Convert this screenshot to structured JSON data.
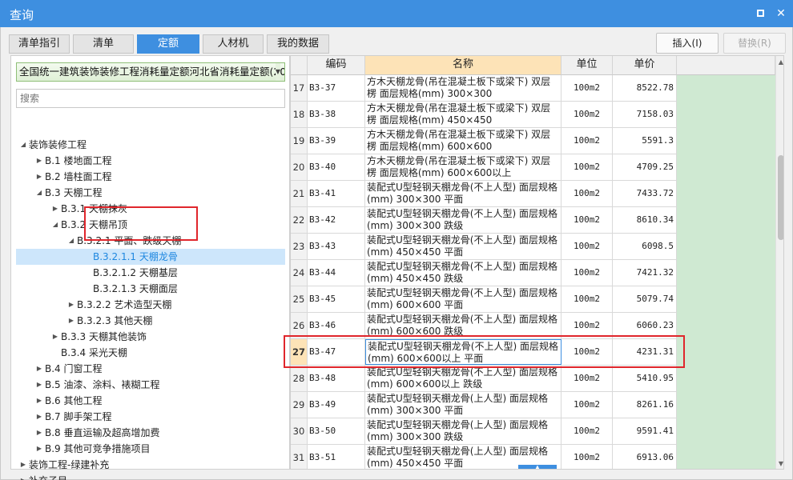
{
  "window": {
    "title": "查询"
  },
  "tabs": [
    {
      "label": "清单指引",
      "active": false
    },
    {
      "label": "清单",
      "active": false
    },
    {
      "label": "定额",
      "active": true
    },
    {
      "label": "人材机",
      "active": false
    },
    {
      "label": "我的数据",
      "active": false
    }
  ],
  "toolbar": {
    "insert_label": "插入(I)",
    "replace_label": "替换(R)"
  },
  "left": {
    "library_select": "全国统一建筑装饰装修工程消耗量定额河北省消耗量定额(20",
    "search_placeholder": "搜索",
    "tree": [
      {
        "label": "装饰装修工程",
        "toggle": "◢"
      },
      {
        "label": "B.1 楼地面工程",
        "toggle": "▶"
      },
      {
        "label": "B.2 墙柱面工程",
        "toggle": "▶"
      },
      {
        "label": "B.3 天棚工程",
        "toggle": "◢"
      },
      {
        "label": "B.3.1 天棚抹灰",
        "toggle": "▶"
      },
      {
        "label": "B.3.2 天棚吊顶",
        "toggle": "◢"
      },
      {
        "label": "B.3.2.1 平面、跌级天棚",
        "toggle": "◢"
      },
      {
        "label": "B.3.2.1.1 天棚龙骨",
        "toggle": "",
        "selected": true
      },
      {
        "label": "B.3.2.1.2 天棚基层",
        "toggle": ""
      },
      {
        "label": "B.3.2.1.3 天棚面层",
        "toggle": ""
      },
      {
        "label": "B.3.2.2 艺术造型天棚",
        "toggle": "▶"
      },
      {
        "label": "B.3.2.3 其他天棚",
        "toggle": "▶"
      },
      {
        "label": "B.3.3 天棚其他装饰",
        "toggle": "▶"
      },
      {
        "label": "B.3.4 采光天棚",
        "toggle": ""
      },
      {
        "label": "B.4 门窗工程",
        "toggle": "▶"
      },
      {
        "label": "B.5 油漆、涂料、裱糊工程",
        "toggle": "▶"
      },
      {
        "label": "B.6 其他工程",
        "toggle": "▶"
      },
      {
        "label": "B.7 脚手架工程",
        "toggle": "▶"
      },
      {
        "label": "B.8 垂直运输及超高增加费",
        "toggle": "▶"
      },
      {
        "label": "B.9 其他可竞争措施项目",
        "toggle": "▶"
      },
      {
        "label": "装饰工程-绿建补充",
        "toggle": "▶"
      },
      {
        "label": "补充子目",
        "toggle": "▶"
      }
    ]
  },
  "table": {
    "headers": {
      "code": "编码",
      "name": "名称",
      "unit": "单位",
      "price": "单价"
    },
    "rows": [
      {
        "num": "17",
        "code": "B3-37",
        "name": "方木天棚龙骨(吊在混凝土板下或梁下) 双层楞 面层规格(mm) 300×300",
        "unit": "100m2",
        "price": "8522.78"
      },
      {
        "num": "18",
        "code": "B3-38",
        "name": "方木天棚龙骨(吊在混凝土板下或梁下) 双层楞 面层规格(mm) 450×450",
        "unit": "100m2",
        "price": "7158.03"
      },
      {
        "num": "19",
        "code": "B3-39",
        "name": "方木天棚龙骨(吊在混凝土板下或梁下) 双层楞 面层规格(mm) 600×600",
        "unit": "100m2",
        "price": "5591.3"
      },
      {
        "num": "20",
        "code": "B3-40",
        "name": "方木天棚龙骨(吊在混凝土板下或梁下) 双层楞 面层规格(mm) 600×600以上",
        "unit": "100m2",
        "price": "4709.25"
      },
      {
        "num": "21",
        "code": "B3-41",
        "name": "装配式U型轻钢天棚龙骨(不上人型) 面层规格(mm) 300×300 平面",
        "unit": "100m2",
        "price": "7433.72"
      },
      {
        "num": "22",
        "code": "B3-42",
        "name": "装配式U型轻钢天棚龙骨(不上人型) 面层规格(mm) 300×300 跌级",
        "unit": "100m2",
        "price": "8610.34"
      },
      {
        "num": "23",
        "code": "B3-43",
        "name": "装配式U型轻钢天棚龙骨(不上人型) 面层规格(mm) 450×450 平面",
        "unit": "100m2",
        "price": "6098.5"
      },
      {
        "num": "24",
        "code": "B3-44",
        "name": "装配式U型轻钢天棚龙骨(不上人型) 面层规格(mm) 450×450 跌级",
        "unit": "100m2",
        "price": "7421.32"
      },
      {
        "num": "25",
        "code": "B3-45",
        "name": "装配式U型轻钢天棚龙骨(不上人型) 面层规格(mm) 600×600 平面",
        "unit": "100m2",
        "price": "5079.74"
      },
      {
        "num": "26",
        "code": "B3-46",
        "name": "装配式U型轻钢天棚龙骨(不上人型) 面层规格(mm) 600×600 跌级",
        "unit": "100m2",
        "price": "6060.23"
      },
      {
        "num": "27",
        "code": "B3-47",
        "name": "装配式U型轻钢天棚龙骨(不上人型) 面层规格(mm) 600×600以上 平面",
        "unit": "100m2",
        "price": "4231.31",
        "active": true
      },
      {
        "num": "28",
        "code": "B3-48",
        "name": "装配式U型轻钢天棚龙骨(不上人型) 面层规格(mm) 600×600以上 跌级",
        "unit": "100m2",
        "price": "5410.95"
      },
      {
        "num": "29",
        "code": "B3-49",
        "name": "装配式U型轻钢天棚龙骨(上人型) 面层规格(mm) 300×300 平面",
        "unit": "100m2",
        "price": "8261.16"
      },
      {
        "num": "30",
        "code": "B3-50",
        "name": "装配式U型轻钢天棚龙骨(上人型) 面层规格(mm) 300×300 跌级",
        "unit": "100m2",
        "price": "9591.41"
      },
      {
        "num": "31",
        "code": "B3-51",
        "name": "装配式U型轻钢天棚龙骨(上人型) 面层规格(mm) 450×450 平面",
        "unit": "100m2",
        "price": "6913.06"
      }
    ]
  },
  "colors": {
    "accent": "#3e8fe0",
    "highlight": "#e0262c",
    "price_fill": "#cfe9d2",
    "header_active": "#fde3b7"
  }
}
